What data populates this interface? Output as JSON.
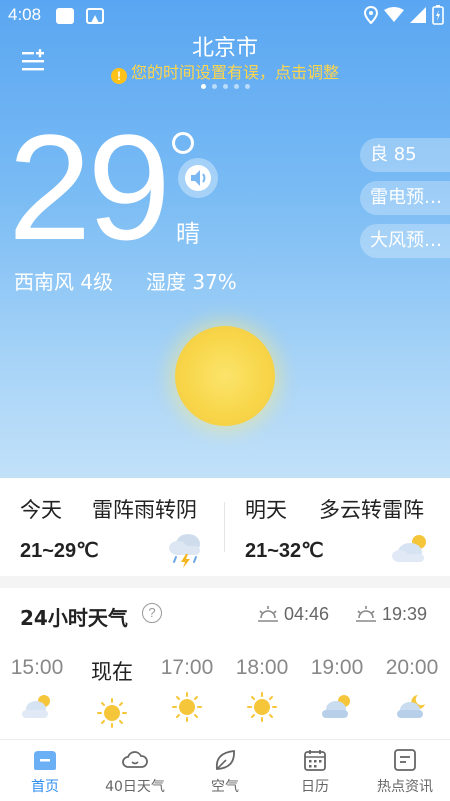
{
  "status_bar": {
    "time": "4:08"
  },
  "header": {
    "city": "北京市",
    "warning_text": "您的时间设置有误，点击调整",
    "page_count": 5,
    "active_page": 0
  },
  "current": {
    "temperature": "29",
    "condition": "晴",
    "wind": "西南风 4级",
    "humidity": "湿度 37%"
  },
  "side_pills": [
    {
      "label": "良 85"
    },
    {
      "label": "雷电预…"
    },
    {
      "label": "大风预…"
    }
  ],
  "forecast": {
    "today": {
      "day": "今天",
      "desc": "雷阵雨转阴",
      "range": "21~29℃",
      "icon": "thunderstorm-icon"
    },
    "tomorrow": {
      "day": "明天",
      "desc": "多云转雷阵",
      "range": "21~32℃",
      "icon": "partly-cloudy-icon"
    }
  },
  "hourly": {
    "title": "24小时天气",
    "help": "?",
    "sunrise": "04:46",
    "sunset": "19:39",
    "hours": [
      {
        "label": "15:00",
        "icon": "partly-cloudy-icon"
      },
      {
        "label": "现在",
        "icon": "sunny-icon"
      },
      {
        "label": "17:00",
        "icon": "sunny-icon"
      },
      {
        "label": "18:00",
        "icon": "sunny-icon"
      },
      {
        "label": "19:00",
        "icon": "partly-cloudy-icon"
      },
      {
        "label": "20:00",
        "icon": "cloudy-night-icon"
      }
    ]
  },
  "nav": [
    {
      "label": "首页",
      "icon": "home-icon",
      "active": true
    },
    {
      "label": "40日天气",
      "icon": "cloud-icon",
      "active": false
    },
    {
      "label": "空气",
      "icon": "leaf-icon",
      "active": false
    },
    {
      "label": "日历",
      "icon": "calendar-icon",
      "active": false
    },
    {
      "label": "热点资讯",
      "icon": "news-icon",
      "active": false
    }
  ],
  "colors": {
    "accent": "#2f8ef2",
    "warning": "#ffd54a",
    "sun": "#f8d64a",
    "text_primary": "#222222",
    "text_secondary": "#888888"
  }
}
